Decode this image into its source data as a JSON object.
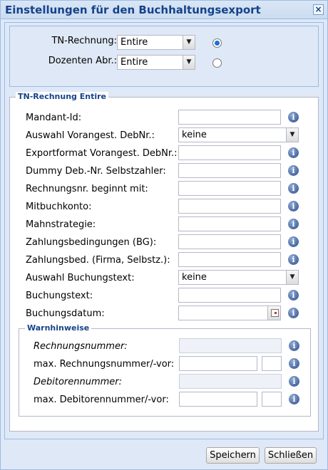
{
  "window": {
    "title": "Einstellungen für den Buchhaltungsexport",
    "close_symbol": "×"
  },
  "selection": {
    "tn_label": "TN-Rechnung:",
    "tn_value": "Entire",
    "tn_selected": true,
    "doz_label": "Dozenten Abr.:",
    "doz_value": "Entire",
    "doz_selected": false
  },
  "tn_section": {
    "legend": "TN-Rechnung Entire",
    "fields": {
      "mandant": {
        "label": "Mandant-Id:",
        "value": ""
      },
      "auswahl_debnr": {
        "label": "Auswahl Vorangest. DebNr.:",
        "value": "keine"
      },
      "exportformat": {
        "label": "Exportformat Vorangest. DebNr.:",
        "value": ""
      },
      "dummy": {
        "label": "Dummy Deb.-Nr. Selbstzahler:",
        "value": ""
      },
      "rechnungsnr": {
        "label": "Rechnungsnr. beginnt mit:",
        "value": ""
      },
      "mitbuchkonto": {
        "label": "Mitbuchkonto:",
        "value": ""
      },
      "mahnstrategie": {
        "label": "Mahnstrategie:",
        "value": ""
      },
      "zahlungsbed_bg": {
        "label": "Zahlungsbedingungen (BG):",
        "value": ""
      },
      "zahlungsbed_firma": {
        "label": "Zahlungsbed. (Firma, Selbstz.):",
        "value": ""
      },
      "auswahl_buchungstext": {
        "label": "Auswahl Buchungstext:",
        "value": "keine"
      },
      "buchungstext": {
        "label": "Buchungstext:",
        "value": ""
      },
      "buchungsdatum": {
        "label": "Buchungsdatum:",
        "value": ""
      }
    }
  },
  "warn_section": {
    "legend": "Warnhinweise",
    "rechnungsnummer_label": "Rechnungsnummer:",
    "max_rechnungsnummer_label": "max. Rechnungsnummer/-vor:",
    "debitorennummer_label": "Debitorennummer:",
    "max_debitorennummer_label": "max. Debitorennummer/-vor:"
  },
  "footer": {
    "save_label": "Speichern",
    "close_label": "Schließen"
  },
  "icons": {
    "info": "i",
    "dropdown": "▼"
  },
  "colors": {
    "title": "#15428b",
    "border": "#99bbe8",
    "panel_bg": "#dfe8f6",
    "radio_on": "#1e6fd9"
  }
}
